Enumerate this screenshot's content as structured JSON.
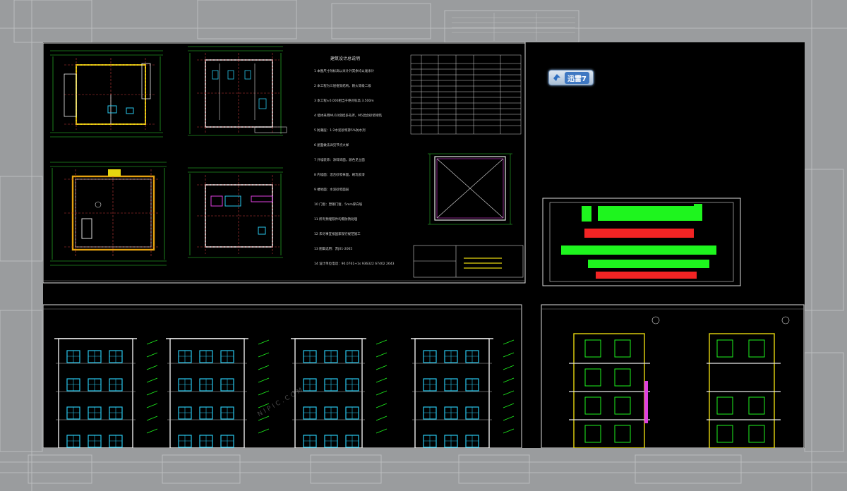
{
  "app": {
    "toolbar": {
      "xunlei_label": "迅雷7",
      "xunlei_icon": "bird-icon"
    },
    "notes": {
      "title": "建筑设计总说明",
      "lines": [
        "1  本图尺寸除标高以米计外其余均以毫米计",
        "2  本工程为三层框架结构，耐火等级二级",
        "3  本工程±0.000相当于绝对标高 3.500m",
        "4  墙体采用MU10烧结多孔砖，M5混合砂浆砌筑",
        "5  防潮层：1:2水泥砂浆掺5%防水剂",
        "6  屋面做法详见节点大样",
        "7  外墙装饰：涂料饰面，颜色见立面",
        "8  内墙面：混合砂浆抹面，刷乳胶漆",
        "9  楼地面：水泥砂浆面层",
        "10 门窗：塑钢门窗，5mm厚白玻",
        "11 所有预埋铁件均需防锈处理",
        "12 未尽事宜按国家现行规范施工",
        "13 图集选用：苏J01-2005",
        "14 设计单位电话：90.0761+1s 936322 67402 2643"
      ]
    },
    "watermark": "NIPIC.COM",
    "colors": {
      "cad_bg": "#000000",
      "wall": "#e6d70f",
      "axis": "#c83a3a",
      "dim": "#2fd52f",
      "window": "#29c8ee",
      "bar_green": "#1ef51e",
      "bar_red": "#f22424"
    }
  }
}
